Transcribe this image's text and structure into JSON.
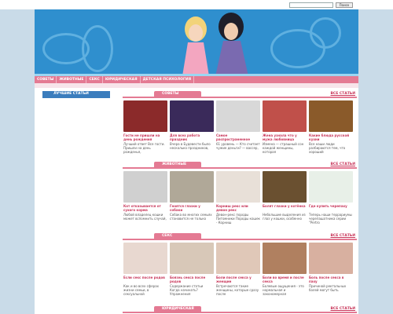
{
  "search": {
    "placeholder": "",
    "button_label": "Поиск"
  },
  "nav": [
    "СОВЕТЫ",
    "ЖИВОТНЫЕ",
    "СЕКС",
    "ЮРИДИЧЕСКАЯ",
    "ДЕТСКАЯ ПСИХОЛОГИЯ"
  ],
  "sidebar": {
    "title": "ЛУЧШИЕ СТАТЬИ"
  },
  "colors": {
    "accent": "#e47a93",
    "link": "#c8365a",
    "banner": "#2f8fce",
    "sidebar_title": "#3b7dbd"
  },
  "sections": [
    {
      "title": "СОВЕТЫ",
      "all_link": "ВСЕ СТАТЬИ",
      "cards": [
        {
          "title": "Гости не пришли на день рождения",
          "text": "Лучший ответ Все гости. Пришли на день рожденья,",
          "thumb": "#8b2a2a"
        },
        {
          "title": "Для всех работа праздник",
          "text": "Вчера в Будевести было несколько праздников,",
          "thumb": "#3a2a5a"
        },
        {
          "title": "Самое распространенное",
          "text": "61 уровень — Кто считает чужие деньги? — вассер,",
          "thumb": "#d8d8d8"
        },
        {
          "title": "Жена узнала что у мужа любовница",
          "text": "Измена — страшный сон каждой женщины, которая",
          "thumb": "#c0504a"
        },
        {
          "title": "Какие блюда русской кухни",
          "text": "Все наши люди разбираются тем, что хороший",
          "thumb": "#8a5a2a"
        }
      ]
    },
    {
      "title": "ЖИВОТНЫЕ",
      "all_link": "ВСЕ СТАТЬИ",
      "cards": [
        {
          "title": "Кот отказывается от сухого корма",
          "text": "Любой владелец кошки может вспомнить случай,",
          "thumb": "#d0d0d0"
        },
        {
          "title": "Гноятся глазки у собаки",
          "text": "Собака во многих семьях становится не только",
          "thumb": "#b0a898"
        },
        {
          "title": "Корниш рекс или девон рекс",
          "text": "Девон-рекс породы Питомники Породы кошек - Корниш",
          "thumb": "#e8e0d8"
        },
        {
          "title": "Болят глазки у котёнка",
          "text": "Небольшие выделения из глаз у кошки, особенно",
          "thumb": "#6a5030"
        },
        {
          "title": "Где купить черепаху",
          "text": "Теперь наши террариумы черепашатника серии \"Pertro",
          "thumb": "#e8f0e8"
        }
      ]
    },
    {
      "title": "СЕКС",
      "all_link": "ВСЕ СТАТЬИ",
      "cards": [
        {
          "title": "Если секс после родов",
          "text": "Как и во всех сферах жизни семьи, в сексуальной",
          "thumb": "#e8d8d0"
        },
        {
          "title": "Боязнь секса после родов",
          "text": "Содержание статьи Когда начинать? Упражнения",
          "thumb": "#d8c8b8"
        },
        {
          "title": "Боли после секса у женщин",
          "text": "Встречаются такие женщины, которые сразу после",
          "thumb": "#e0c8b8"
        },
        {
          "title": "Боли во время и после секса",
          "text": "Болевые ощущения - это нормальная и закономерная",
          "thumb": "#b08060"
        },
        {
          "title": "Боль после секса в паху",
          "text": "Причиной ректальных болей могут быть",
          "thumb": "#d8b0a0"
        }
      ]
    },
    {
      "title": "ЮРИДИЧЕСКАЯ",
      "all_link": "ВСЕ СТАТЬИ",
      "cards": []
    }
  ]
}
